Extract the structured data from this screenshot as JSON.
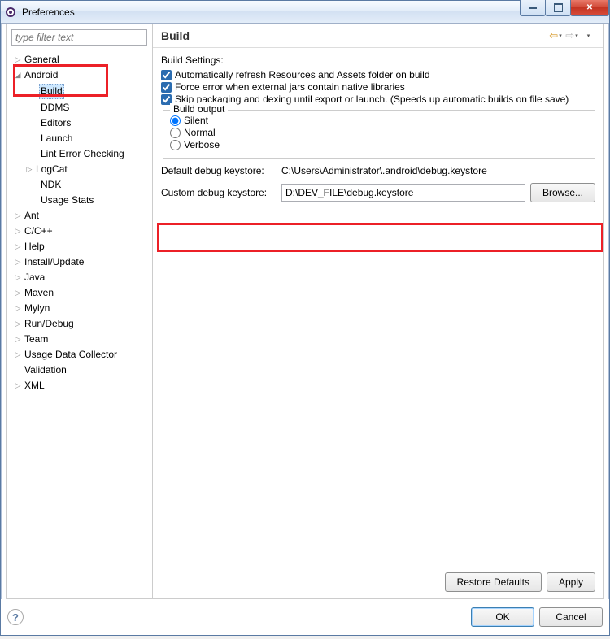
{
  "window": {
    "title": "Preferences"
  },
  "filter": {
    "placeholder": "type filter text"
  },
  "tree": {
    "general": "General",
    "android": "Android",
    "build": "Build",
    "ddms": "DDMS",
    "editors": "Editors",
    "launch": "Launch",
    "lint": "Lint Error Checking",
    "logcat": "LogCat",
    "ndk": "NDK",
    "usage_stats": "Usage Stats",
    "ant": "Ant",
    "cpp": "C/C++",
    "help": "Help",
    "install": "Install/Update",
    "java": "Java",
    "maven": "Maven",
    "mylyn": "Mylyn",
    "rundebug": "Run/Debug",
    "team": "Team",
    "udc": "Usage Data Collector",
    "validation": "Validation",
    "xml": "XML"
  },
  "main": {
    "heading": "Build",
    "settings_label": "Build Settings:",
    "check1": "Automatically refresh Resources and Assets folder on build",
    "check2": "Force error when external jars contain native libraries",
    "check3": "Skip packaging and dexing until export or launch. (Speeds up automatic builds on file save)",
    "output_legend": "Build output",
    "radio_silent": "Silent",
    "radio_normal": "Normal",
    "radio_verbose": "Verbose",
    "default_ks_label": "Default debug keystore:",
    "default_ks_value": "C:\\Users\\Administrator\\.android\\debug.keystore",
    "custom_ks_label": "Custom debug keystore:",
    "custom_ks_value": "D:\\DEV_FILE\\debug.keystore",
    "browse": "Browse...",
    "restore": "Restore Defaults",
    "apply": "Apply"
  },
  "footer": {
    "ok": "OK",
    "cancel": "Cancel"
  }
}
